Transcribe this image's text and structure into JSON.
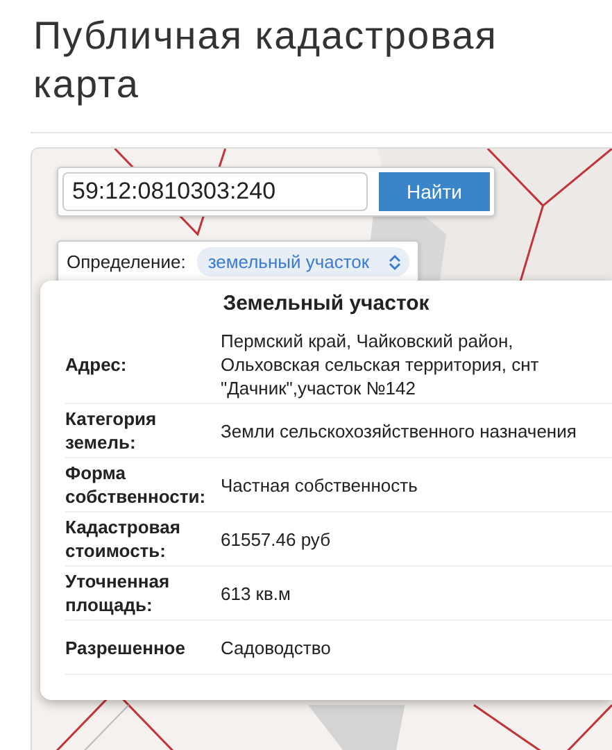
{
  "title": "Публичная кадастровая карта",
  "search": {
    "value": "59:12:0810303:240",
    "button": "Найти"
  },
  "definition": {
    "label": "Определение:",
    "value": "земельный участок"
  },
  "popup": {
    "title": "Земельный участок",
    "rows": [
      {
        "label": "Адрес:",
        "value": "Пермский край, Чайковский район, Ольховская сельская территория, снт \"Дачник\",участок №142"
      },
      {
        "label": "Категория земель:",
        "value": "Земли сельскохозяйственного назначения"
      },
      {
        "label": "Форма собственности:",
        "value": "Частная собственность"
      },
      {
        "label": "Кадастровая стоимость:",
        "value": "61557.46 руб"
      },
      {
        "label": "Уточненная площадь:",
        "value": "613 кв.м"
      },
      {
        "label": "Разрешенное",
        "value": "Садоводство"
      }
    ]
  }
}
